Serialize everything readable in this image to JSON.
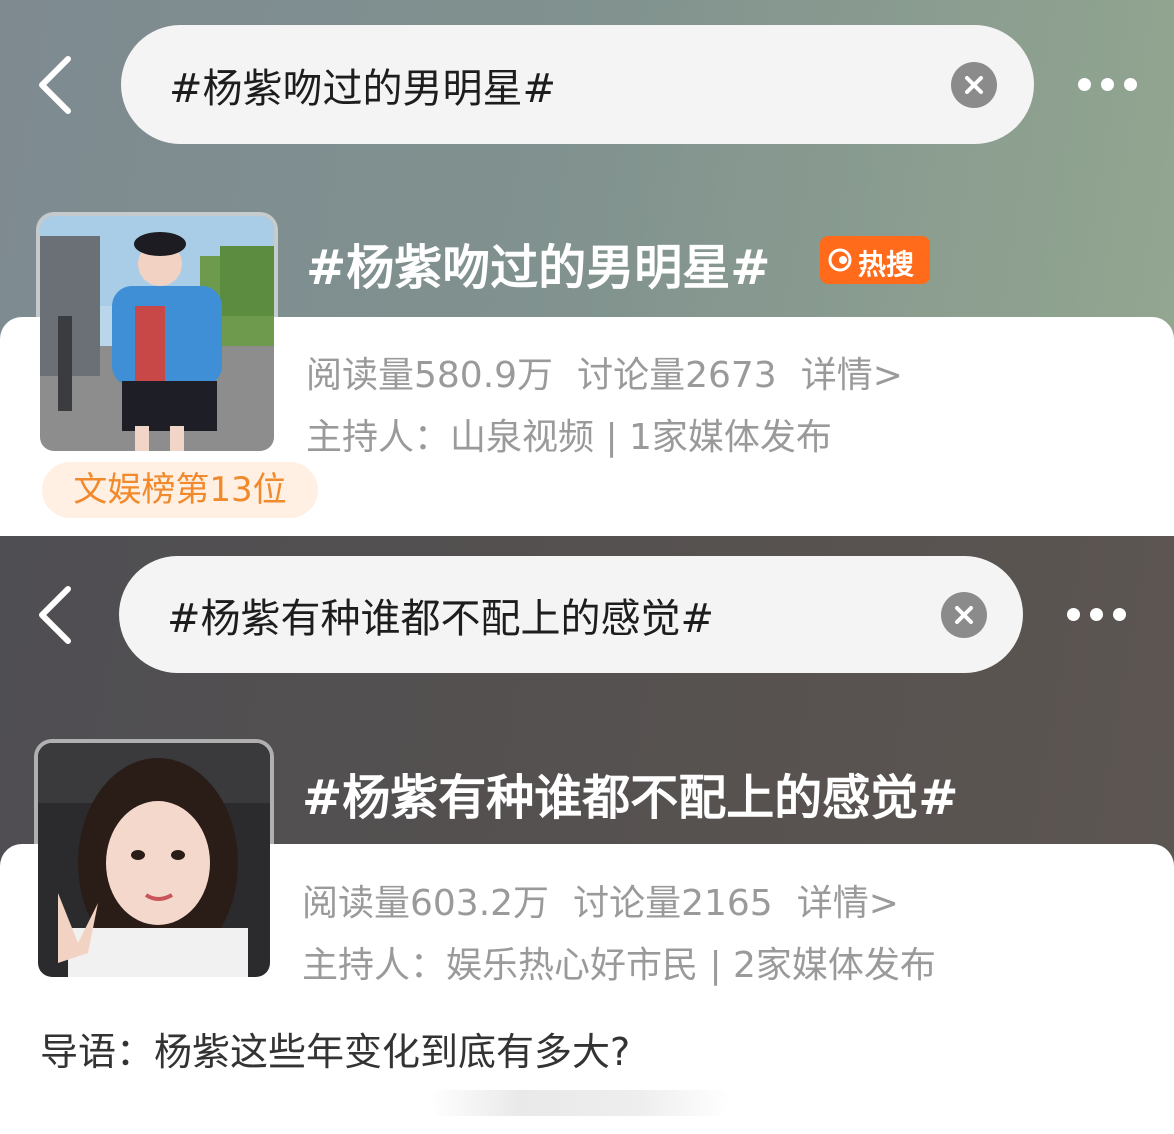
{
  "entries": [
    {
      "search_query": "#杨紫吻过的男明星#",
      "topic_title": "#杨紫吻过的男明星#",
      "badge": "热搜",
      "reads": "阅读量580.9万",
      "discussions": "讨论量2673",
      "details": "详情>",
      "host": "主持人：山泉视频 | 1家媒体发布",
      "rank": "文娱榜第13位"
    },
    {
      "search_query": "#杨紫有种谁都不配上的感觉#",
      "topic_title": "#杨紫有种谁都不配上的感觉#",
      "reads": "阅读量603.2万",
      "discussions": "讨论量2165",
      "details": "详情>",
      "host": "主持人：娱乐热心好市民 | 2家媒体发布",
      "lead": "导语：杨紫这些年变化到底有多大?"
    }
  ],
  "icons": {
    "back": "chevron-left-icon",
    "clear": "close-circle-icon",
    "more": "more-dots-icon",
    "hot": "hot-search-icon"
  },
  "colors": {
    "hot_badge": "#ff6b1a",
    "rank_text": "#f08a2c",
    "rank_bg": "#fff0e3"
  }
}
